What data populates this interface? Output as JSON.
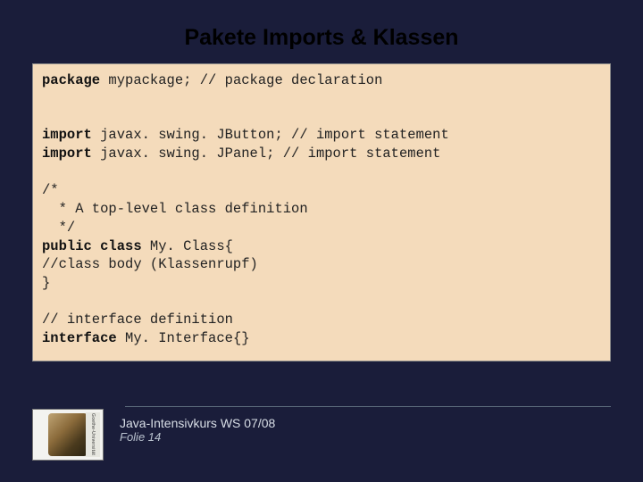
{
  "title": "Pakete Imports & Klassen",
  "code": {
    "l1a": "package",
    "l1b": " mypackage; // package declaration",
    "l2a": "import",
    "l2b": " javax. swing. JButton; // import statement",
    "l3a": "import",
    "l3b": " javax. swing. JPanel; // import statement",
    "l4": "/*",
    "l5": "  * A top-level class definition",
    "l6": "  */",
    "l7a": "public class",
    "l7b": " My. Class{",
    "l8": "//class body (Klassenrupf)",
    "l9": "}",
    "l10": "// interface definition",
    "l11a": "interface",
    "l11b": " My. Interface{}"
  },
  "footer": {
    "course": "Java-Intensivkurs WS 07/08",
    "folie": "Folie 14",
    "logo_side": "Goethe-Universität"
  }
}
